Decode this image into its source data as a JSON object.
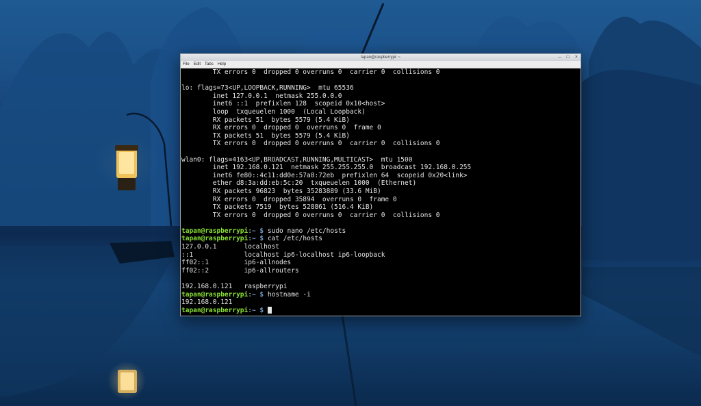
{
  "window": {
    "title": "tapan@raspberrypi: ~",
    "controls": [
      "–",
      "□",
      "×"
    ],
    "menu": [
      "File",
      "Edit",
      "Tabs",
      "Help"
    ]
  },
  "terminal": {
    "output": [
      "        TX errors 0  dropped 0 overruns 0  carrier 0  collisions 0",
      "",
      "lo: flags=73<UP,LOOPBACK,RUNNING>  mtu 65536",
      "        inet 127.0.0.1  netmask 255.0.0.0",
      "        inet6 ::1  prefixlen 128  scopeid 0x10<host>",
      "        loop  txqueuelen 1000  (Local Loopback)",
      "        RX packets 51  bytes 5579 (5.4 KiB)",
      "        RX errors 0  dropped 0  overruns 0  frame 0",
      "        TX packets 51  bytes 5579 (5.4 KiB)",
      "        TX errors 0  dropped 0 overruns 0  carrier 0  collisions 0",
      "",
      "wlan0: flags=4163<UP,BROADCAST,RUNNING,MULTICAST>  mtu 1500",
      "        inet 192.168.0.121  netmask 255.255.255.0  broadcast 192.168.0.255",
      "        inet6 fe80::4c11:dd0e:57a8:72eb  prefixlen 64  scopeid 0x20<link>",
      "        ether d8:3a:dd:eb:5c:20  txqueuelen 1000  (Ethernet)",
      "        RX packets 96823  bytes 35283889 (33.6 MiB)",
      "        RX errors 0  dropped 35894  overruns 0  frame 0",
      "        TX packets 7519  bytes 528861 (516.4 KiB)",
      "        TX errors 0  dropped 0 overruns 0  carrier 0  collisions 0",
      ""
    ],
    "prompt": {
      "user": "tapan@raspberrypi",
      "sep": ":",
      "path": "~",
      "symbol": " $ "
    },
    "commands": {
      "cmd1": "sudo nano /etc/hosts",
      "cmd2": "cat /etc/hosts",
      "hosts": [
        "127.0.0.1       localhost",
        "::1             localhost ip6-localhost ip6-loopback",
        "ff02::1         ip6-allnodes",
        "ff02::2         ip6-allrouters",
        "",
        "192.168.0.121   raspberrypi"
      ],
      "cmd3": "hostname -i",
      "hostname_out": "192.168.0.121"
    }
  }
}
